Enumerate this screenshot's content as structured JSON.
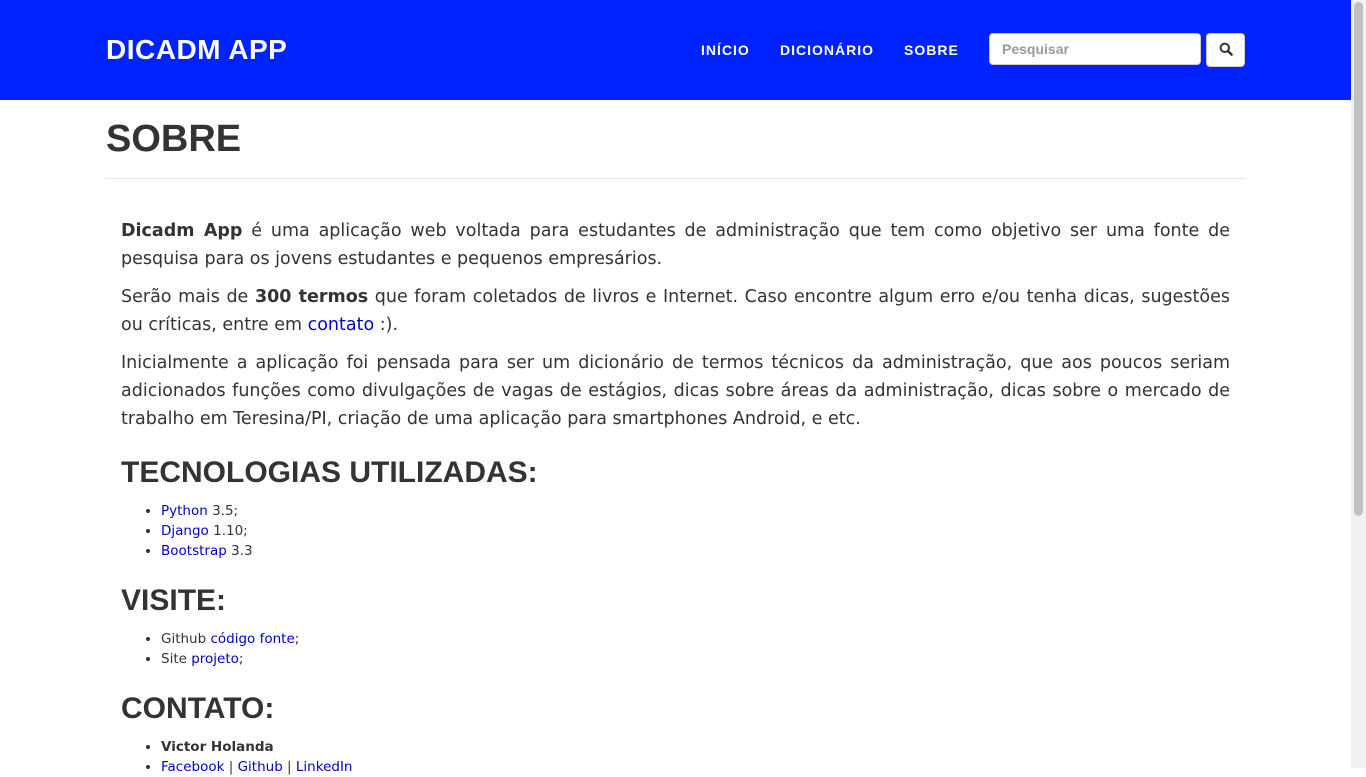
{
  "navbar": {
    "brand": "DICADM APP",
    "links": [
      "INÍCIO",
      "DICIONÁRIO",
      "SOBRE"
    ],
    "search_placeholder": "Pesquisar",
    "search_icon": "search-icon",
    "background": "#0022ff"
  },
  "page": {
    "title": "SOBRE"
  },
  "intro": {
    "p1_strong": "Dicadm App",
    "p1_rest": " é uma aplicação web voltada para estudantes de administração que tem como objetivo ser uma fonte de pesquisa para os jovens estudantes e pequenos empresários.",
    "p2_a": "Serão mais de ",
    "p2_strong": "300 termos",
    "p2_b": " que foram coletados de livros e Internet. Caso encontre algum erro e/ou tenha dicas, sugestões ou críticas, entre em ",
    "p2_link": "contato",
    "p2_c": " :).",
    "p3": "Inicialmente a aplicação foi pensada para ser um dicionário de termos técnicos da administração, que aos poucos seriam adicionados funções como divulgações de vagas de estágios, dicas sobre áreas da administração, dicas sobre o mercado de trabalho em Teresina/PI, criação de uma aplicação para smartphones Android, e etc."
  },
  "tecnologias": {
    "title": "TECNOLOGIAS UTILIZADAS:",
    "items": [
      {
        "link": "Python",
        "text": " 3.5;"
      },
      {
        "link": "Django",
        "text": " 1.10;"
      },
      {
        "link": "Bootstrap",
        "text": " 3.3"
      }
    ]
  },
  "visite": {
    "title": "VISITE:",
    "items": [
      {
        "prefix": "Github ",
        "link": "código fonte",
        "suffix": ";"
      },
      {
        "prefix": "Site ",
        "link": "projeto",
        "suffix": ";"
      }
    ]
  },
  "contato": {
    "title": "CONTATO:",
    "name": "Victor Holanda",
    "links": [
      "Facebook",
      "Github",
      "LinkedIn"
    ],
    "separator": " | "
  }
}
